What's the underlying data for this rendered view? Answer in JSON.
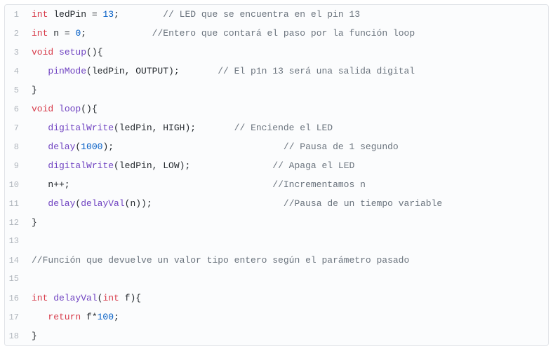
{
  "code": {
    "lines": [
      {
        "n": "1",
        "tokens": [
          {
            "t": "int ",
            "c": "kw"
          },
          {
            "t": "ledPin ",
            "c": "plain"
          },
          {
            "t": "= ",
            "c": "plain"
          },
          {
            "t": "13",
            "c": "num"
          },
          {
            "t": ";        ",
            "c": "plain"
          },
          {
            "t": "// LED que se encuentra en el pin 13",
            "c": "cmt"
          }
        ]
      },
      {
        "n": "2",
        "tokens": [
          {
            "t": "int ",
            "c": "kw"
          },
          {
            "t": "n ",
            "c": "plain"
          },
          {
            "t": "= ",
            "c": "plain"
          },
          {
            "t": "0",
            "c": "num"
          },
          {
            "t": ";            ",
            "c": "plain"
          },
          {
            "t": "//Entero que contará el paso por la función loop",
            "c": "cmt"
          }
        ]
      },
      {
        "n": "3",
        "tokens": [
          {
            "t": "void ",
            "c": "kw"
          },
          {
            "t": "setup",
            "c": "fn"
          },
          {
            "t": "(){",
            "c": "plain"
          }
        ]
      },
      {
        "n": "4",
        "tokens": [
          {
            "t": "   ",
            "c": "plain"
          },
          {
            "t": "pinMode",
            "c": "fn"
          },
          {
            "t": "(ledPin, OUTPUT);       ",
            "c": "plain"
          },
          {
            "t": "// El p1n 13 será una salida digital",
            "c": "cmt"
          }
        ]
      },
      {
        "n": "5",
        "tokens": [
          {
            "t": "}",
            "c": "plain"
          }
        ]
      },
      {
        "n": "6",
        "tokens": [
          {
            "t": "void ",
            "c": "kw"
          },
          {
            "t": "loop",
            "c": "fn"
          },
          {
            "t": "(){",
            "c": "plain"
          }
        ]
      },
      {
        "n": "7",
        "tokens": [
          {
            "t": "   ",
            "c": "plain"
          },
          {
            "t": "digitalWrite",
            "c": "fn"
          },
          {
            "t": "(ledPin, HIGH);       ",
            "c": "plain"
          },
          {
            "t": "// Enciende el LED",
            "c": "cmt"
          }
        ]
      },
      {
        "n": "8",
        "tokens": [
          {
            "t": "   ",
            "c": "plain"
          },
          {
            "t": "delay",
            "c": "fn"
          },
          {
            "t": "(",
            "c": "plain"
          },
          {
            "t": "1000",
            "c": "num"
          },
          {
            "t": ");                               ",
            "c": "plain"
          },
          {
            "t": "// Pausa de 1 segundo",
            "c": "cmt"
          }
        ]
      },
      {
        "n": "9",
        "tokens": [
          {
            "t": "   ",
            "c": "plain"
          },
          {
            "t": "digitalWrite",
            "c": "fn"
          },
          {
            "t": "(ledPin, LOW);               ",
            "c": "plain"
          },
          {
            "t": "// Apaga el LED",
            "c": "cmt"
          }
        ]
      },
      {
        "n": "10",
        "tokens": [
          {
            "t": "   n++;                                     ",
            "c": "plain"
          },
          {
            "t": "//Incrementamos n",
            "c": "cmt"
          }
        ]
      },
      {
        "n": "11",
        "tokens": [
          {
            "t": "   ",
            "c": "plain"
          },
          {
            "t": "delay",
            "c": "fn"
          },
          {
            "t": "(",
            "c": "plain"
          },
          {
            "t": "delayVal",
            "c": "fn"
          },
          {
            "t": "(n));                        ",
            "c": "plain"
          },
          {
            "t": "//Pausa de un tiempo variable",
            "c": "cmt"
          }
        ]
      },
      {
        "n": "12",
        "tokens": [
          {
            "t": "}",
            "c": "plain"
          }
        ]
      },
      {
        "n": "13",
        "tokens": [
          {
            "t": "",
            "c": "plain"
          }
        ]
      },
      {
        "n": "14",
        "tokens": [
          {
            "t": "//Función que devuelve un valor tipo entero según el parámetro pasado",
            "c": "cmt"
          }
        ]
      },
      {
        "n": "15",
        "tokens": [
          {
            "t": "",
            "c": "plain"
          }
        ]
      },
      {
        "n": "16",
        "tokens": [
          {
            "t": "int ",
            "c": "kw"
          },
          {
            "t": "delayVal",
            "c": "fn"
          },
          {
            "t": "(",
            "c": "plain"
          },
          {
            "t": "int ",
            "c": "kw"
          },
          {
            "t": "f){",
            "c": "plain"
          }
        ]
      },
      {
        "n": "17",
        "tokens": [
          {
            "t": "   ",
            "c": "plain"
          },
          {
            "t": "return ",
            "c": "kw"
          },
          {
            "t": "f*",
            "c": "plain"
          },
          {
            "t": "100",
            "c": "num"
          },
          {
            "t": ";",
            "c": "plain"
          }
        ]
      },
      {
        "n": "18",
        "tokens": [
          {
            "t": "}",
            "c": "plain"
          }
        ]
      }
    ]
  }
}
